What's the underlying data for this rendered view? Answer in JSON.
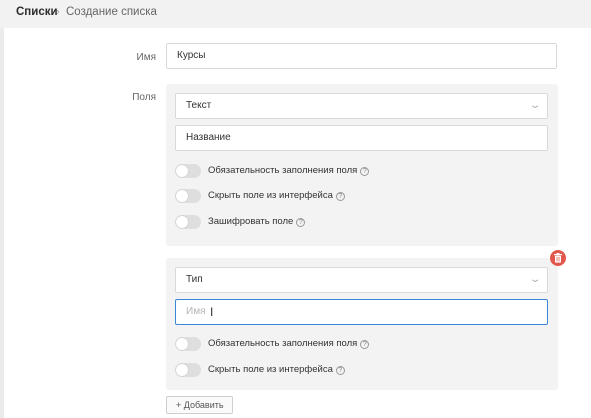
{
  "breadcrumb": {
    "parent": "Списки",
    "separator": "›",
    "current": "Создание списка"
  },
  "form": {
    "name_label": "Имя",
    "name_value": "Курсы",
    "fields_label": "Поля"
  },
  "fields": [
    {
      "type": "Текст",
      "name_value": "Название",
      "toggles": [
        {
          "label": "Обязательность заполнения поля",
          "on": false
        },
        {
          "label": "Скрыть поле из интерфейса",
          "on": false
        },
        {
          "label": "Зашифровать поле",
          "on": false
        }
      ]
    },
    {
      "type": "Тип",
      "name_placeholder": "Имя",
      "toggles": [
        {
          "label": "Обязательность заполнения поля",
          "on": false
        },
        {
          "label": "Скрыть поле из интерфейса",
          "on": false
        }
      ]
    }
  ],
  "help_glyph": "?",
  "add_button": "+ Добавить",
  "colors": {
    "accent": "#3b86d6",
    "danger": "#e2574c"
  },
  "icons": {
    "chevron": "chevron-down-icon",
    "delete": "trash-icon",
    "help": "question-circle-icon"
  }
}
